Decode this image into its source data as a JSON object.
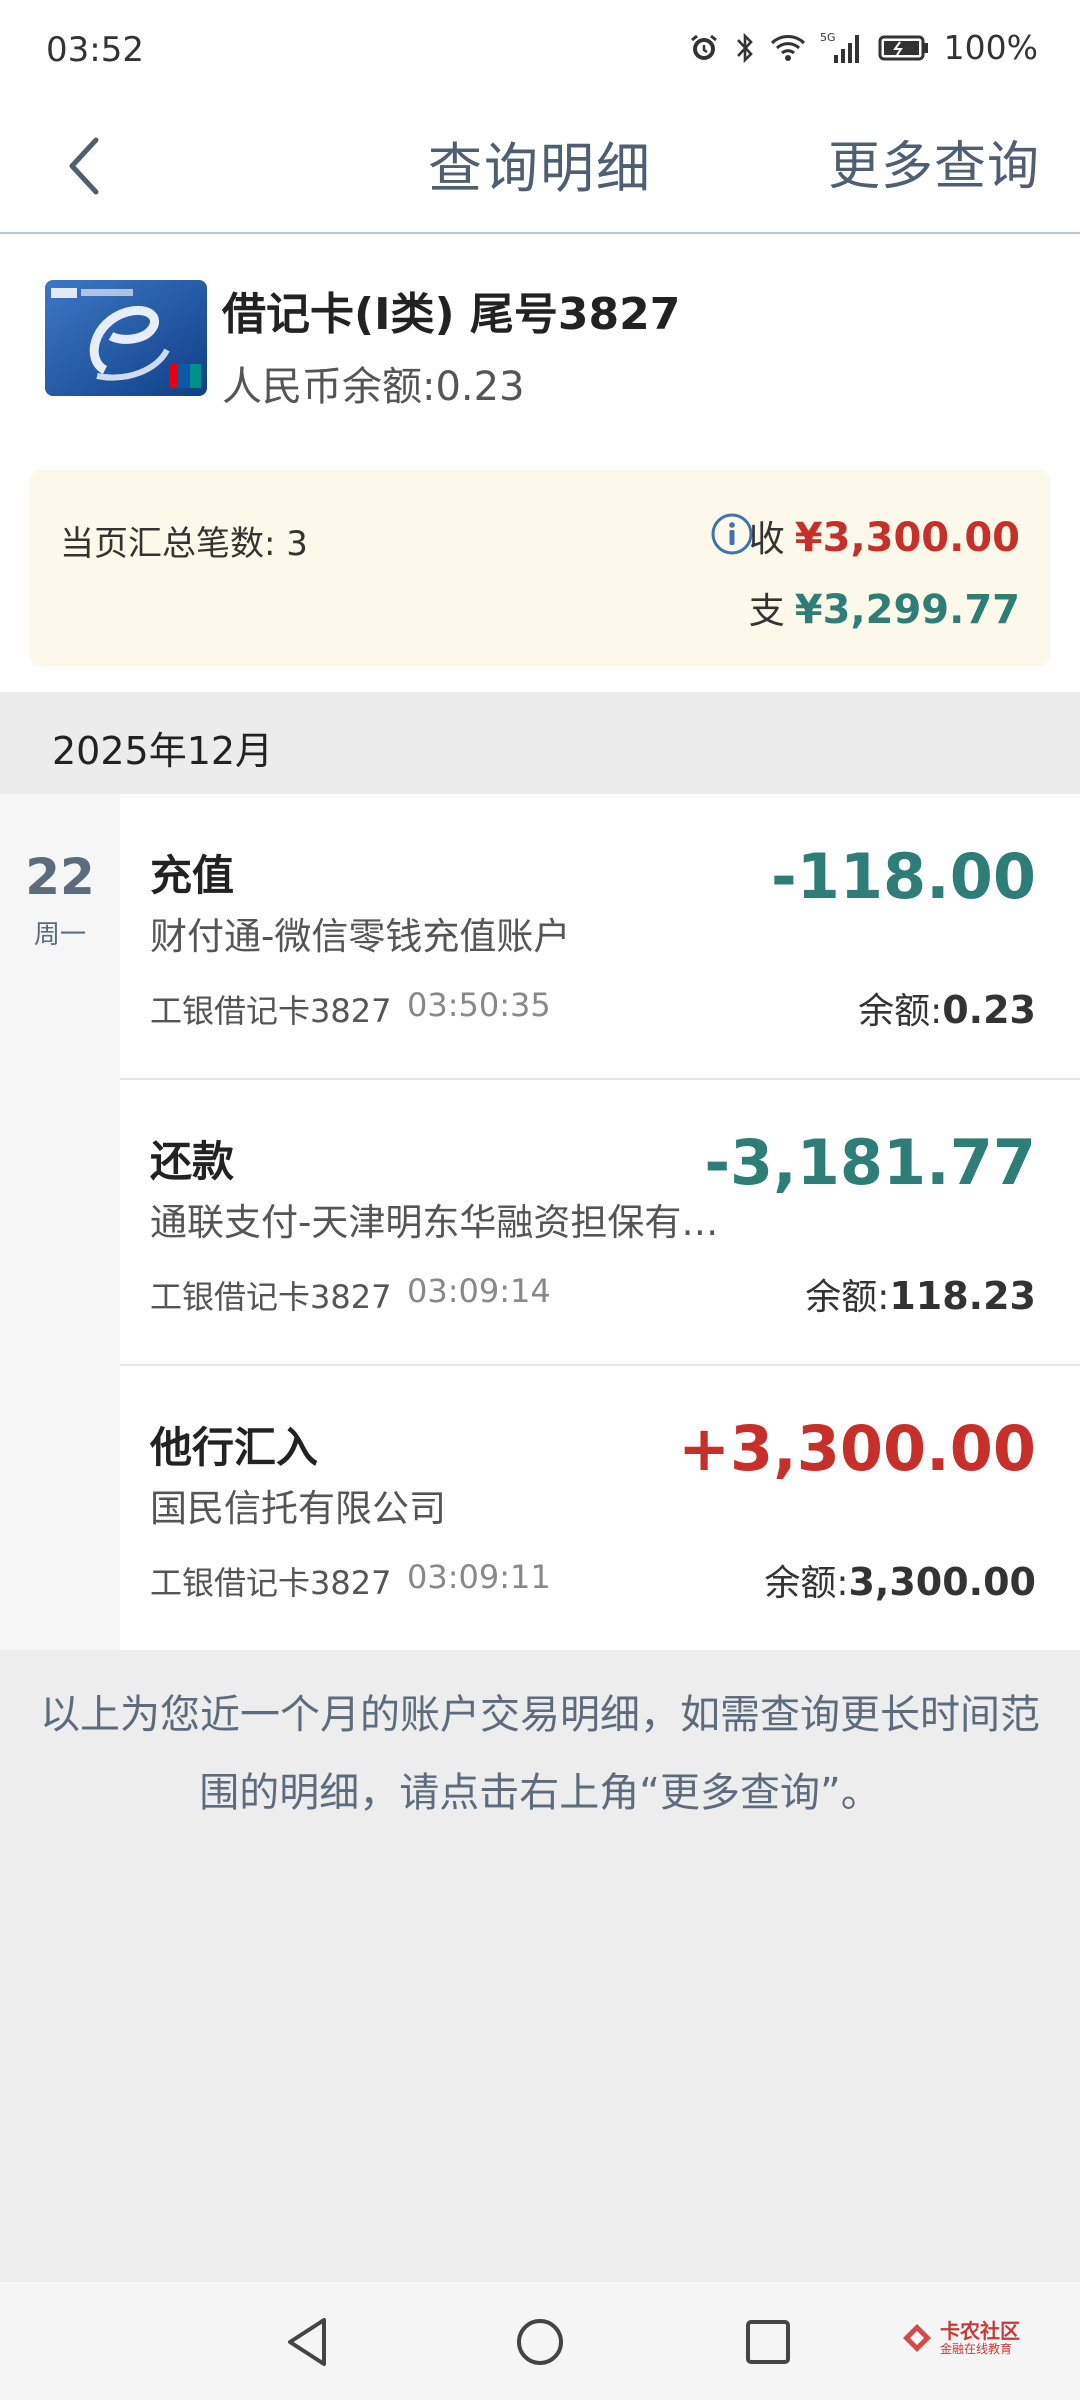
{
  "status_bar": {
    "time": "03:52",
    "battery": "100%",
    "network": "5G"
  },
  "nav": {
    "title": "查询明细",
    "more": "更多查询"
  },
  "account": {
    "name": "借记卡(I类) 尾号3827",
    "balance": "人民币余额:0.23"
  },
  "summary": {
    "count_text": "当页汇总笔数: 3",
    "in_label": "收",
    "in_amount": "¥3,300.00",
    "out_label": "支",
    "out_amount": "¥3,299.77"
  },
  "month": "2025年12月",
  "day": {
    "num": "22",
    "weekday": "周一"
  },
  "transactions": [
    {
      "type": "充值",
      "desc": "财付通-微信零钱充值账户",
      "account": "工银借记卡3827",
      "time": "03:50:35",
      "amount": "-118.00",
      "balance_label": "余额:",
      "balance": "0.23"
    },
    {
      "type": "还款",
      "desc": "通联支付-天津明东华融资担保有…",
      "account": "工银借记卡3827",
      "time": "03:09:14",
      "amount": "-3,181.77",
      "balance_label": "余额:",
      "balance": "118.23"
    },
    {
      "type": "他行汇入",
      "desc": "国民信托有限公司",
      "account": "工银借记卡3827",
      "time": "03:09:11",
      "amount": "+3,300.00",
      "balance_label": "余额:",
      "balance": "3,300.00"
    }
  ],
  "note": "以上为您近一个月的账户交易明细，如需查询更长时间范围的明细，请点击右上角“更多查询”。",
  "watermark": {
    "brand": "卡农社区",
    "sub": "金融在线教育"
  },
  "colors": {
    "income": "#c7302a",
    "expense": "#2e7e77",
    "accent": "#4f5f71"
  }
}
